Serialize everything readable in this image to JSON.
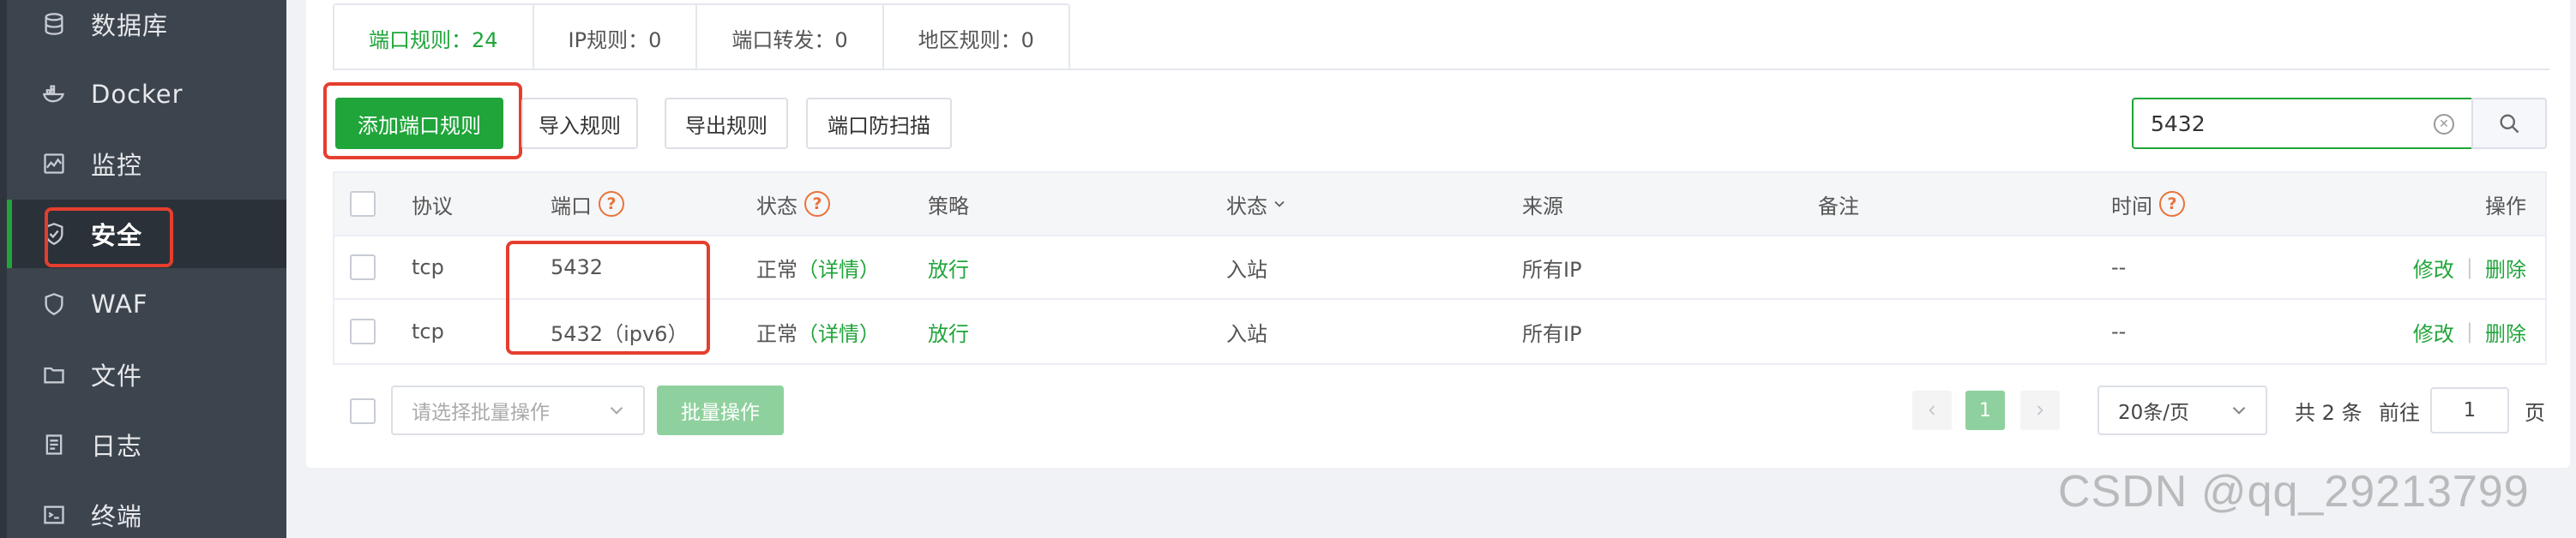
{
  "sidebar": {
    "items": [
      {
        "label": "数据库",
        "icon": "database-icon"
      },
      {
        "label": "Docker",
        "icon": "docker-icon"
      },
      {
        "label": "监控",
        "icon": "monitor-icon"
      },
      {
        "label": "安全",
        "icon": "shield-icon",
        "active": true
      },
      {
        "label": "WAF",
        "icon": "waf-icon"
      },
      {
        "label": "文件",
        "icon": "folder-icon"
      },
      {
        "label": "日志",
        "icon": "log-icon"
      },
      {
        "label": "终端",
        "icon": "terminal-icon"
      }
    ]
  },
  "tabs": [
    {
      "label": "端口规则：24",
      "active": true
    },
    {
      "label": "IP规则：0"
    },
    {
      "label": "端口转发：0"
    },
    {
      "label": "地区规则：0"
    }
  ],
  "toolbar": {
    "add_label": "添加端口规则",
    "import_label": "导入规则",
    "export_label": "导出规则",
    "scan_label": "端口防扫描"
  },
  "search": {
    "value": "5432",
    "icon": "search-icon",
    "clear_icon": "clear-icon"
  },
  "table": {
    "headers": {
      "protocol": "协议",
      "port": "端口",
      "status": "状态",
      "policy": "策略",
      "direction": "状态",
      "source": "来源",
      "remark": "备注",
      "time": "时间",
      "action": "操作"
    },
    "help_glyph": "?",
    "rows": [
      {
        "protocol": "tcp",
        "port": "5432",
        "status": "正常",
        "detail": "（详情）",
        "policy": "放行",
        "direction": "入站",
        "source": "所有IP",
        "remark": "",
        "time": "--",
        "edit": "修改",
        "delete": "删除"
      },
      {
        "protocol": "tcp",
        "port": "5432（ipv6）",
        "status": "正常",
        "detail": "（详情）",
        "policy": "放行",
        "direction": "入站",
        "source": "所有IP",
        "remark": "",
        "time": "--",
        "edit": "修改",
        "delete": "删除"
      }
    ]
  },
  "footer": {
    "batch_placeholder": "请选择批量操作",
    "batch_button": "批量操作",
    "current_page": "1",
    "page_size": "20条/页",
    "total_text": "共 2 条",
    "goto_label": "前往",
    "goto_value": "1",
    "page_unit": "页"
  },
  "watermark": "CSDN @qq_29213799",
  "colors": {
    "accent": "#20a53a",
    "highlight": "#e53e2e",
    "sidebar": "#3c444d"
  }
}
